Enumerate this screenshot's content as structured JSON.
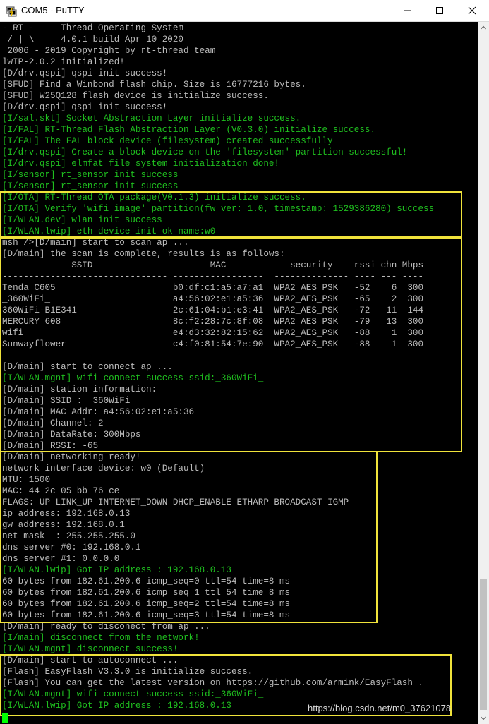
{
  "window": {
    "title": "COM5 - PuTTY",
    "icons": [
      "putty-app-icon",
      "minimize-icon",
      "maximize-icon",
      "close-icon",
      "scroll-up-arrow-icon",
      "scroll-down-arrow-icon"
    ]
  },
  "colors": {
    "default_text": "#bbbbbb",
    "green_text": "#1fbf1f",
    "highlight_box": "#f0e33b",
    "cursor": "#00ff00"
  },
  "terminal": {
    "lines": [
      {
        "text": "- RT -     Thread Operating System",
        "color": "default"
      },
      {
        "text": " / | \\     4.0.1 build Apr 10 2020",
        "color": "default"
      },
      {
        "text": " 2006 - 2019 Copyright by rt-thread team",
        "color": "default"
      },
      {
        "text": "lwIP-2.0.2 initialized!",
        "color": "default"
      },
      {
        "text": "[D/drv.qspi] qspi init success!",
        "color": "default"
      },
      {
        "text": "[SFUD] Find a Winbond flash chip. Size is 16777216 bytes.",
        "color": "default"
      },
      {
        "text": "[SFUD] W25Q128 flash device is initialize success.",
        "color": "default"
      },
      {
        "text": "[D/drv.qspi] qspi init success!",
        "color": "default"
      },
      {
        "text": "[I/sal.skt] Socket Abstraction Layer initialize success.",
        "color": "green"
      },
      {
        "text": "[I/FAL] RT-Thread Flash Abstraction Layer (V0.3.0) initialize success.",
        "color": "green"
      },
      {
        "text": "[I/FAL] The FAL block device (filesystem) created successfully",
        "color": "green"
      },
      {
        "text": "[I/drv.qspi] Create a block device on the 'filesystem' partition successful!",
        "color": "green"
      },
      {
        "text": "[I/drv.qspi] elmfat file system initialization done!",
        "color": "green"
      },
      {
        "text": "[I/sensor] rt_sensor init success",
        "color": "green"
      },
      {
        "text": "[I/sensor] rt_sensor init success",
        "color": "green"
      },
      {
        "text": "[I/OTA] RT-Thread OTA package(V0.1.3) initialize success.",
        "color": "green"
      },
      {
        "text": "[I/OTA] Verify 'wifi_image' partition(fw ver: 1.0, timestamp: 1529386280) success",
        "color": "green"
      },
      {
        "text": "[I/WLAN.dev] wlan init success",
        "color": "green"
      },
      {
        "text": "[I/WLAN.lwip] eth device init ok name:w0",
        "color": "green"
      },
      {
        "text": "msh />[D/main] start to scan ap ...",
        "color": "default"
      },
      {
        "text": "[D/main] the scan is complete, results is as follows:",
        "color": "default"
      },
      {
        "text": "             SSID                      MAC            security    rssi chn Mbps",
        "color": "default"
      },
      {
        "text": "------------------------------- -----------------  -------------- ---- --- ----",
        "color": "default"
      },
      {
        "text": "Tenda_C605                      b0:df:c1:a5:a7:a1  WPA2_AES_PSK   -52    6  300",
        "color": "default"
      },
      {
        "text": "_360WiFi_                       a4:56:02:e1:a5:36  WPA2_AES_PSK   -65    2  300",
        "color": "default"
      },
      {
        "text": "360WiFi-B1E341                  2c:61:04:b1:e3:41  WPA2_AES_PSK   -72   11  144",
        "color": "default"
      },
      {
        "text": "MERCURY_608                     8c:f2:28:7c:8f:08  WPA2_AES_PSK   -79   13  300",
        "color": "default"
      },
      {
        "text": "wifi                            e4:d3:32:82:15:62  WPA2_AES_PSK   -88    1  300",
        "color": "default"
      },
      {
        "text": "Sunwayflower                    c4:f0:81:54:7e:90  WPA2_AES_PSK   -88    1  300",
        "color": "default"
      },
      {
        "text": "",
        "color": "default"
      },
      {
        "text": "[D/main] start to connect ap ...",
        "color": "default"
      },
      {
        "text": "[I/WLAN.mgnt] wifi connect success ssid:_360WiFi_",
        "color": "green"
      },
      {
        "text": "[D/main] station information:",
        "color": "default"
      },
      {
        "text": "[D/main] SSID : _360WiFi_",
        "color": "default"
      },
      {
        "text": "[D/main] MAC Addr: a4:56:02:e1:a5:36",
        "color": "default"
      },
      {
        "text": "[D/main] Channel: 2",
        "color": "default"
      },
      {
        "text": "[D/main] DataRate: 300Mbps",
        "color": "default"
      },
      {
        "text": "[D/main] RSSI: -65",
        "color": "default"
      },
      {
        "text": "[D/main] networking ready!",
        "color": "default"
      },
      {
        "text": "network interface device: w0 (Default)",
        "color": "default"
      },
      {
        "text": "MTU: 1500",
        "color": "default"
      },
      {
        "text": "MAC: 44 2c 05 bb 76 ce",
        "color": "default"
      },
      {
        "text": "FLAGS: UP LINK_UP INTERNET_DOWN DHCP_ENABLE ETHARP BROADCAST IGMP",
        "color": "default"
      },
      {
        "text": "ip address: 192.168.0.13",
        "color": "default"
      },
      {
        "text": "gw address: 192.168.0.1",
        "color": "default"
      },
      {
        "text": "net mask  : 255.255.255.0",
        "color": "default"
      },
      {
        "text": "dns server #0: 192.168.0.1",
        "color": "default"
      },
      {
        "text": "dns server #1: 0.0.0.0",
        "color": "default"
      },
      {
        "text": "[I/WLAN.lwip] Got IP address : 192.168.0.13",
        "color": "green"
      },
      {
        "text": "60 bytes from 182.61.200.6 icmp_seq=0 ttl=54 time=8 ms",
        "color": "default"
      },
      {
        "text": "60 bytes from 182.61.200.6 icmp_seq=1 ttl=54 time=8 ms",
        "color": "default"
      },
      {
        "text": "60 bytes from 182.61.200.6 icmp_seq=2 ttl=54 time=8 ms",
        "color": "default"
      },
      {
        "text": "60 bytes from 182.61.200.6 icmp_seq=3 ttl=54 time=8 ms",
        "color": "default"
      },
      {
        "text": "[D/main] ready to disconect from ap ...",
        "color": "default"
      },
      {
        "text": "[I/main] disconnect from the network!",
        "color": "green"
      },
      {
        "text": "[I/WLAN.mgnt] disconnect success!",
        "color": "green"
      },
      {
        "text": "[D/main] start to autoconnect ...",
        "color": "default"
      },
      {
        "text": "[Flash] EasyFlash V3.3.0 is initialize success.",
        "color": "default"
      },
      {
        "text": "[Flash] You can get the latest version on https://github.com/armink/EasyFlash .",
        "color": "default"
      },
      {
        "text": "[I/WLAN.mgnt] wifi connect success ssid:_360WiFi_",
        "color": "green"
      },
      {
        "text": "[I/WLAN.lwip] Got IP address : 192.168.0.13",
        "color": "green"
      }
    ]
  },
  "watermark": "https://blog.csdn.net/m0_37621078"
}
